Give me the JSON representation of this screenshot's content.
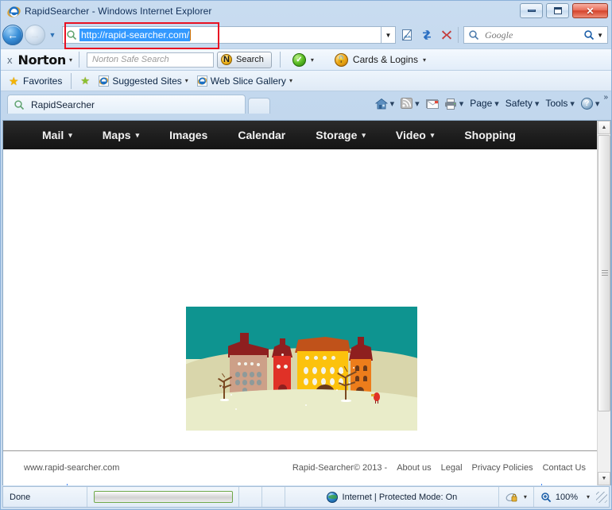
{
  "window": {
    "title": "RapidSearcher - Windows Internet Explorer",
    "minimize_label": "Minimize",
    "maximize_label": "Maximize",
    "close_label": "Close"
  },
  "navigation": {
    "back_label": "Back",
    "forward_label": "Forward",
    "recent_pages_label": "Recent Pages",
    "address_value": "http://rapid-searcher.com/",
    "address_dropdown_label": "Address dropdown",
    "compatibility_label": "Compatibility View",
    "refresh_label": "Refresh",
    "stop_label": "Stop",
    "search_placeholder": "Google",
    "search_go_label": "Search",
    "search_dropdown_label": "Search provider dropdown"
  },
  "norton_bar": {
    "close_label": "x",
    "brand": "Norton",
    "brand_caret": "▾",
    "search_placeholder": "Norton Safe Search",
    "search_button": "Search",
    "safe_caret": "▾",
    "cards_logins": "Cards & Logins",
    "cards_caret": "▾"
  },
  "favorites_bar": {
    "favorites": "Favorites",
    "suggested_sites": "Suggested Sites",
    "web_slice_gallery": "Web Slice Gallery",
    "caret": "▾"
  },
  "tabs": {
    "items": [
      {
        "label": "RapidSearcher"
      }
    ],
    "new_tab_label": "New Tab"
  },
  "command_bar": {
    "home_label": "Home",
    "feeds_label": "Feeds",
    "mail_label": "Read Mail",
    "print_label": "Print",
    "page": "Page",
    "safety": "Safety",
    "tools": "Tools",
    "help": "?",
    "caret": "▾",
    "overflow": "»"
  },
  "site_nav": {
    "items": [
      {
        "label": "Mail",
        "has_caret": true
      },
      {
        "label": "Maps",
        "has_caret": true
      },
      {
        "label": "Images",
        "has_caret": false
      },
      {
        "label": "Calendar",
        "has_caret": false
      },
      {
        "label": "Storage",
        "has_caret": true
      },
      {
        "label": "Video",
        "has_caret": true
      },
      {
        "label": "Shopping",
        "has_caret": false
      }
    ],
    "caret": "▾"
  },
  "page_content": {
    "hero_image_alt": "winter village houses illustration",
    "search_input_value": "",
    "search_input_placeholder": ""
  },
  "page_footer": {
    "site_url": "www.rapid-searcher.com",
    "copyright": "Rapid-Searcher© 2013 -",
    "links": [
      {
        "label": "About us"
      },
      {
        "label": "Legal"
      },
      {
        "label": "Privacy Policies"
      },
      {
        "label": "Contact Us"
      }
    ]
  },
  "status_bar": {
    "status": "Done",
    "zone": "Internet | Protected Mode: On",
    "zoom": "100%",
    "caret": "▾"
  },
  "colors": {
    "accent_blue": "#3399ff",
    "annotation_red": "#e81123",
    "site_nav_bg": "#1d1d1d",
    "search_border": "#4285f4",
    "illustration_sky": "#0e9490",
    "illustration_ground": "#d9d6ab",
    "illustration_snow": "#e9ecc9",
    "house_yellow": "#fcc20d",
    "house_red": "#e03127",
    "house_tan": "#cda088",
    "house_orange": "#ed7d1b",
    "roof_dark_red": "#8e1f1f"
  }
}
